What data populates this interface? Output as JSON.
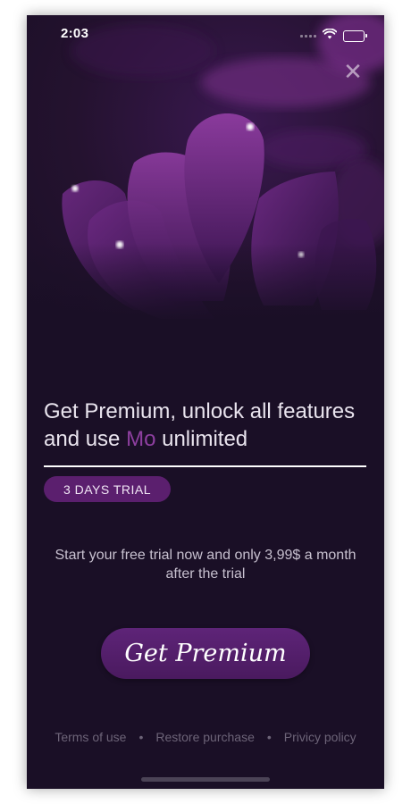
{
  "status_bar": {
    "time": "2:03",
    "signal_icon": "signal-dots-icon",
    "wifi_icon": "wifi-icon",
    "battery_icon": "battery-icon"
  },
  "close_icon": "close-icon",
  "headline": {
    "before": "Get Premium, unlock all features and use ",
    "accent": "Mo",
    "after": " unlimited"
  },
  "trial_badge": "3 DAYS TRIAL",
  "description": "Start your free trial now and only 3,99$ a month after the trial",
  "cta_label": "Get Premium",
  "footer": {
    "terms": "Terms of use",
    "separator": "•",
    "restore": "Restore purchase",
    "privacy": "Privicy policy"
  },
  "colors": {
    "background": "#1a0f26",
    "accent": "#8e3fa0",
    "badge": "#5b1f6e",
    "button": "#5e2478"
  }
}
